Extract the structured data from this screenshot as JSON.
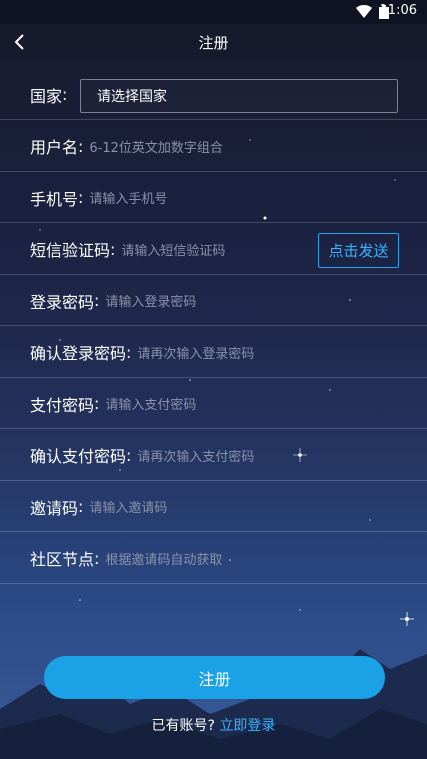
{
  "status_bar": {
    "time": "11:06",
    "wifi_icon": "wifi-icon",
    "battery_icon": "battery-icon"
  },
  "nav": {
    "title": "注册",
    "back_icon": "chevron-left-icon"
  },
  "form": {
    "country": {
      "label": "国家",
      "value": "请选择国家"
    },
    "username": {
      "label": "用户名",
      "placeholder": "6-12位英文加数字组合"
    },
    "phone": {
      "label": "手机号",
      "placeholder": "请输入手机号"
    },
    "sms_code": {
      "label": "短信验证码",
      "placeholder": "请输入短信验证码",
      "send_label": "点击发送"
    },
    "login_password": {
      "label": "登录密码",
      "placeholder": "请输入登录密码"
    },
    "confirm_login_password": {
      "label": "确认登录密码",
      "placeholder": "请再次输入登录密码"
    },
    "pay_password": {
      "label": "支付密码",
      "placeholder": "请输入支付密码"
    },
    "confirm_pay_password": {
      "label": "确认支付密码",
      "placeholder": "请再次输入支付密码"
    },
    "invite_code": {
      "label": "邀请码",
      "placeholder": "请输入邀请码"
    },
    "community_node": {
      "label": "社区节点",
      "placeholder": "根据邀请码自动获取"
    }
  },
  "actions": {
    "register_label": "注册",
    "login_prefix": "已有账号?",
    "login_link": "立即登录"
  },
  "colors": {
    "accent": "#1aa1e6",
    "link": "#37b4ff",
    "background": "#1b2140"
  }
}
